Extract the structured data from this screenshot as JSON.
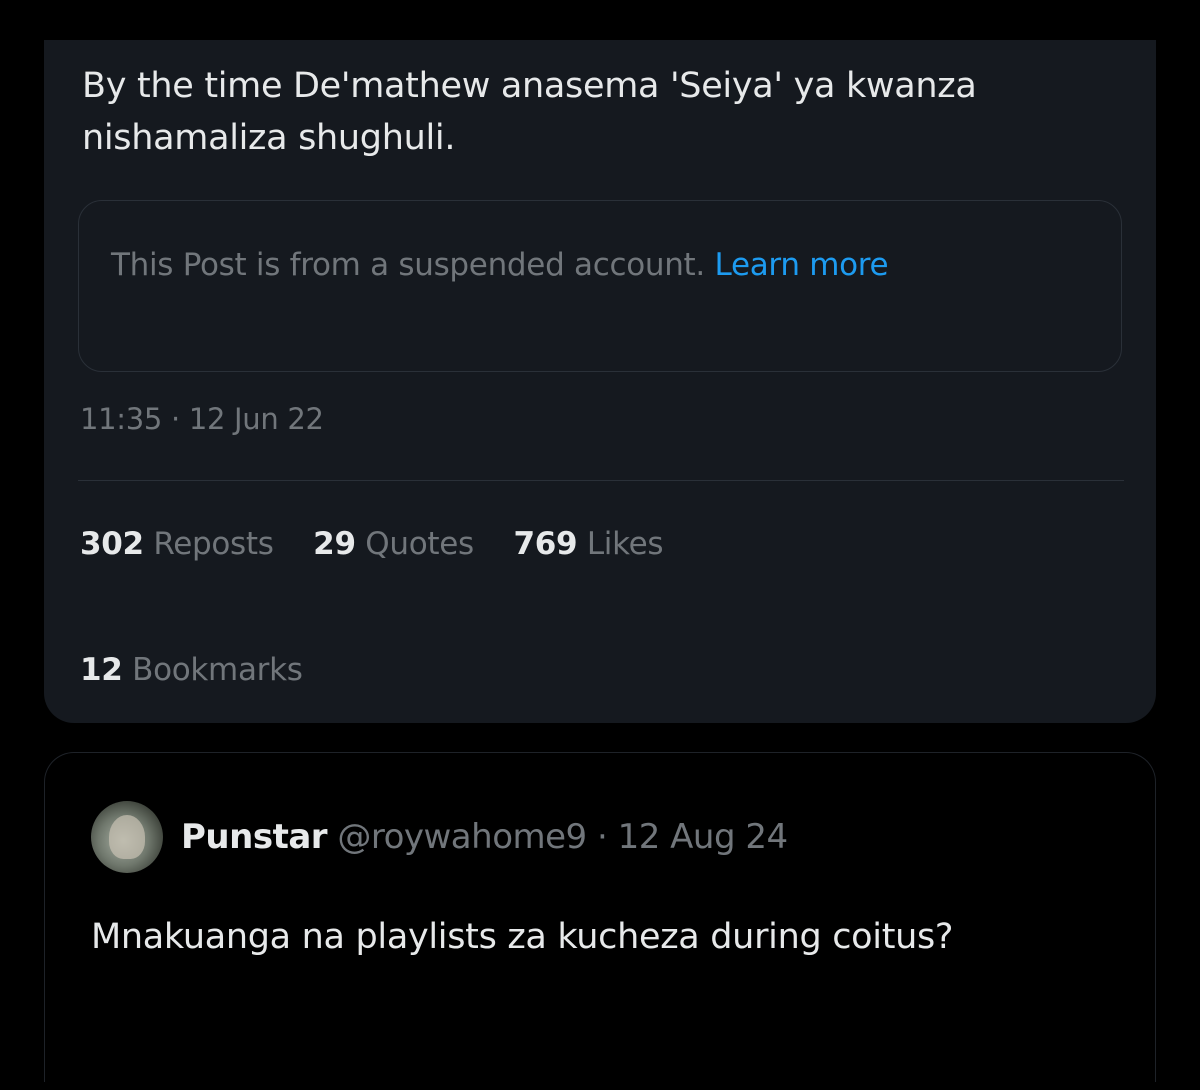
{
  "post": {
    "text": "By the time De'mathew anasema 'Seiya' ya kwanza nishamaliza shughuli.",
    "notice": {
      "text": "This Post is from a suspended account.",
      "link_label": "Learn more"
    },
    "timestamp": "11:35 · 12 Jun 22",
    "stats": {
      "reposts": {
        "count": "302",
        "label": "Reposts"
      },
      "quotes": {
        "count": "29",
        "label": "Quotes"
      },
      "likes": {
        "count": "769",
        "label": "Likes"
      },
      "bookmarks": {
        "count": "12",
        "label": "Bookmarks"
      }
    }
  },
  "quote": {
    "author_name": "Punstar",
    "handle_date": "@roywahome9 · 12 Aug 24",
    "text": "Mnakuanga na playlists za kucheza during coitus?"
  },
  "colors": {
    "background": "#000000",
    "card": "#15191f",
    "text_primary": "#e7e9ea",
    "text_secondary": "#71767b",
    "link": "#1d9bf0"
  }
}
